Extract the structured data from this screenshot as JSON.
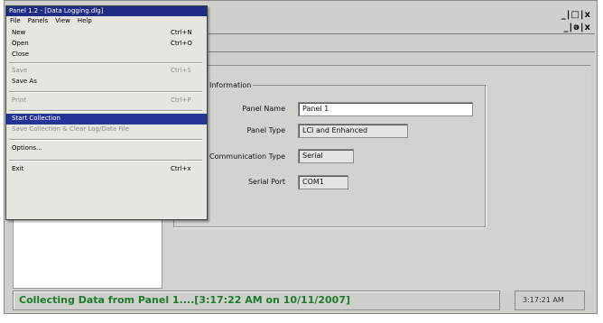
{
  "app": {
    "title": "Panel 1.2 - [Data Logging.dlg]",
    "window_controls": "_|□|x",
    "child_controls": "_|ǝ|x",
    "menubar": [
      "File",
      "Panels",
      "View",
      "Help"
    ]
  },
  "file_menu": {
    "items": [
      {
        "label": "New",
        "shortcut": "Ctrl+N",
        "state": "normal"
      },
      {
        "label": "Open",
        "shortcut": "Ctrl+O",
        "state": "normal"
      },
      {
        "label": "Close",
        "shortcut": "",
        "state": "normal"
      },
      {
        "label": "Save",
        "shortcut": "Ctrl+S",
        "state": "disabled"
      },
      {
        "label": "Save As",
        "shortcut": "",
        "state": "normal"
      },
      {
        "label": "Print",
        "shortcut": "Ctrl+P",
        "state": "disabled"
      },
      {
        "label": "Start Collection",
        "shortcut": "",
        "state": "selected"
      },
      {
        "label": "Save Collection & Clear Log/Data File",
        "shortcut": "",
        "state": "disabled"
      },
      {
        "label": "Options...",
        "shortcut": "",
        "state": "normal"
      },
      {
        "label": "Exit",
        "shortcut": "Ctrl+x",
        "state": "normal"
      }
    ]
  },
  "panel_info": {
    "legend": "Information",
    "fields": [
      {
        "label": "Panel Name",
        "value": "Panel 1"
      },
      {
        "label": "Panel Type",
        "value": "LCI and Enhanced"
      },
      {
        "label": "Communication Type",
        "value": "Serial"
      },
      {
        "label": "Serial Port",
        "value": "COM1"
      }
    ]
  },
  "status": {
    "message": "Collecting Data from Panel 1....[3:17:22 AM on 10/11/2007]",
    "time": "3:17:21 AM"
  }
}
